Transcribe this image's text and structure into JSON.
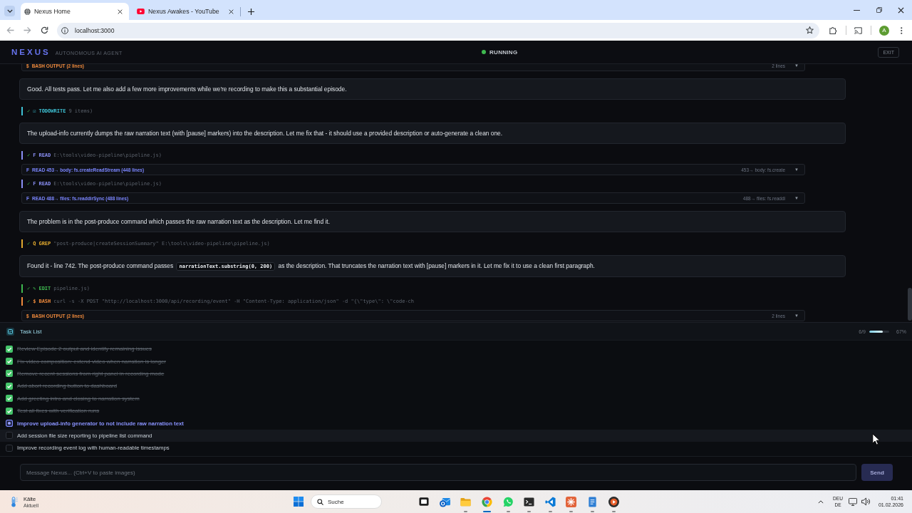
{
  "browser": {
    "tabs": [
      {
        "title": "Nexus Home",
        "selected": true
      },
      {
        "title": "Nexus Awakes - YouTube",
        "selected": false
      }
    ],
    "address": "localhost:3000",
    "avatar": "A"
  },
  "header": {
    "brand": "NEXUS",
    "tagline": "AUTONOMOUS AI AGENT",
    "status": {
      "label": "RUNNING",
      "running": true
    },
    "exit": "EXIT"
  },
  "log": [
    {
      "kind": "output",
      "glyph": "$",
      "label": "BASH OUTPUT (2 lines)",
      "summary": "2 lines",
      "caret": "▼",
      "color": "#ef8a3c"
    },
    {
      "kind": "message",
      "segments": [
        {
          "kind": "text",
          "text": "Good. All tests pass. Let me also add a few more improvements while we're recording to make this a substantial episode."
        }
      ]
    },
    {
      "kind": "tool",
      "status": "✓",
      "glyph": "☑",
      "name": "TODOWRITE",
      "args": "9 items)",
      "color": "#3ec1d3"
    },
    {
      "kind": "message",
      "segments": [
        {
          "kind": "text",
          "text": "The upload-info currently dumps the raw narration text (with [pause] markers) into the description. Let me fix that - it should use a provided description or auto-generate a clean one."
        }
      ]
    },
    {
      "kind": "tool",
      "status": "✓",
      "glyph": "F",
      "name": "READ",
      "args": "E:\\tools\\video-pipeline\\pipeline.js)",
      "color": "#8a8ff5"
    },
    {
      "kind": "output",
      "glyph": "F",
      "label": "READ 453→ body: fs.createReadStream (448 lines)",
      "summary": "453→ body: fs.create",
      "caret": "▼",
      "color": "#7b86ff"
    },
    {
      "kind": "tool",
      "status": "✓",
      "glyph": "F",
      "name": "READ",
      "args": "E:\\tools\\video-pipeline\\pipeline.js)",
      "color": "#8a8ff5"
    },
    {
      "kind": "output",
      "glyph": "F",
      "label": "READ 488→ files: fs.readdirSync (488 lines)",
      "summary": "488→ files: fs.readdi",
      "caret": "▼",
      "color": "#7b86ff"
    },
    {
      "kind": "message",
      "segments": [
        {
          "kind": "text",
          "text": "The problem is in the post-produce command which passes the raw narration text as the description. Let me find it."
        }
      ]
    },
    {
      "kind": "tool",
      "status": "✓",
      "glyph": "Q",
      "name": "GREP",
      "args": "\"post-produce|createSessionSummary\" E:\\tools\\video-pipeline\\pipeline.js)",
      "color": "#e0a82e"
    },
    {
      "kind": "message",
      "segments": [
        {
          "kind": "text",
          "text": "Found it - line 742. The post-produce command passes "
        },
        {
          "kind": "code",
          "text": "narrationText.substring(0, 200)"
        },
        {
          "kind": "text",
          "text": " as the description. That truncates the narration text with [pause] markers in it. Let me fix it to use a clean first paragraph."
        }
      ]
    },
    {
      "kind": "tool",
      "status": "✓",
      "glyph": "✎",
      "name": "EDIT",
      "args": "pipeline.js)",
      "color": "#3fb950"
    },
    {
      "kind": "tool",
      "status": "✓",
      "glyph": "$",
      "name": "BASH",
      "args": "curl -s -X POST \"http://localhost:3000/api/recording/event\" -H \"Content-Type: application/json\" -d \"{\\\"type\\\": \\\"code-ch",
      "color": "#ef8a3c"
    },
    {
      "kind": "output",
      "glyph": "$",
      "label": "BASH OUTPUT (2 lines)",
      "summary": "2 lines",
      "caret": "▼",
      "color": "#ef8a3c"
    }
  ],
  "tasks": {
    "title": "Task List",
    "count": "6/9",
    "level": 0.67,
    "percent": "67%",
    "items": [
      {
        "text": "Review Episode 2 output and identify remaining issues",
        "checked": true,
        "in_progress": false,
        "hovered": false
      },
      {
        "text": "Fix video composition: extend video when narration is longer",
        "checked": true,
        "in_progress": false,
        "hovered": false
      },
      {
        "text": "Remove recent sessions from right panel in recording mode",
        "checked": true,
        "in_progress": false,
        "hovered": false
      },
      {
        "text": "Add abort recording button to dashboard",
        "checked": true,
        "in_progress": false,
        "hovered": false
      },
      {
        "text": "Add greeting intro and closing to narration system",
        "checked": true,
        "in_progress": false,
        "hovered": false
      },
      {
        "text": "Test all fixes with verification runs",
        "checked": true,
        "in_progress": false,
        "hovered": false
      },
      {
        "text": "Improve upload-info generator to not include raw narration text",
        "checked": false,
        "in_progress": true,
        "hovered": false
      },
      {
        "text": "Add session file size reporting to pipeline list command",
        "checked": false,
        "in_progress": false,
        "hovered": true
      },
      {
        "text": "Improve recording event log with human-readable timestamps",
        "checked": false,
        "in_progress": false,
        "hovered": false
      }
    ]
  },
  "composer": {
    "placeholder": "Message Nexus... (Ctrl+V to paste images)",
    "send": {
      "label": "Send",
      "disabled": true
    }
  },
  "taskbar": {
    "weather": {
      "title": "Kälte",
      "subtitle": "Aktuell"
    },
    "search": {
      "placeholder": "Suche"
    },
    "apps": [
      {
        "running": false,
        "active": false
      },
      {
        "running": true,
        "active": false
      },
      {
        "running": true,
        "active": true
      },
      {
        "running": true,
        "active": false
      },
      {
        "running": true,
        "active": false
      },
      {
        "running": true,
        "active": false
      },
      {
        "running": true,
        "active": false
      },
      {
        "running": true,
        "active": false
      },
      {
        "running": true,
        "active": false
      }
    ],
    "tray": {
      "language": "DEU",
      "layout": "DE",
      "time": "01:41",
      "date": "01.02.2026"
    }
  }
}
